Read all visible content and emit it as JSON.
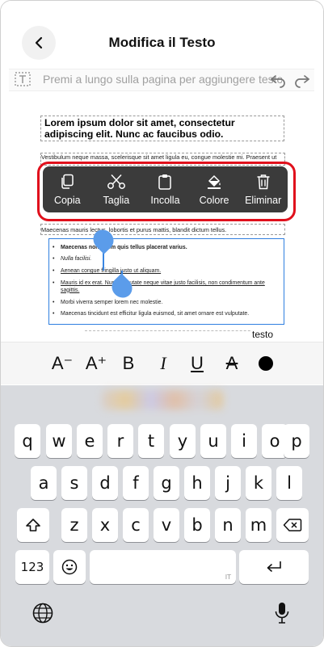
{
  "header": {
    "title": "Modifica il Testo"
  },
  "hint_bar": {
    "text": "Premi a lungo sulla pagina per aggiungere testo"
  },
  "document": {
    "heading": "Lorem ipsum dolor sit amet, consectetur adipiscing elit. Nunc ac faucibus odio.",
    "para1": "Vestibulum neque massa, scelerisque sit amet ligula eu, congue molestie mi. Praesent ut",
    "para2": "Maecenas mauris lectus, lobortis et purus mattis, blandit dictum tellus.",
    "list": [
      "Maecenas non lorem quis tellus placerat varius.",
      "Nulla facilisi.",
      "Aenean congue fringilla justo ut aliquam.",
      "Mauris id ex erat. Nunc vulputate neque vitae justo facilisis, non condimentum ante sagittis.",
      "Morbi viverra semper lorem nec molestie.",
      "Maecenas tincidunt est efficitur ligula euismod, sit amet ornare est vulputate."
    ],
    "testo_tag": "testo"
  },
  "context_menu": {
    "items": [
      {
        "label": "Copia",
        "icon": "copy-icon"
      },
      {
        "label": "Taglia",
        "icon": "scissors-icon"
      },
      {
        "label": "Incolla",
        "icon": "clipboard-icon"
      },
      {
        "label": "Colore",
        "icon": "paint-bucket-icon"
      },
      {
        "label": "Eliminar",
        "icon": "trash-icon"
      }
    ],
    "highlight_color": "#e0101c"
  },
  "format_bar": {
    "decrease_font": "A⁻",
    "increase_font": "A⁺",
    "bold": "B",
    "italic": "I",
    "underline": "U",
    "strikethrough": "A"
  },
  "keyboard": {
    "row1": [
      "q",
      "w",
      "e",
      "r",
      "t",
      "y",
      "u",
      "i",
      "o",
      "p"
    ],
    "row2": [
      "a",
      "s",
      "d",
      "f",
      "g",
      "h",
      "j",
      "k",
      "l"
    ],
    "row3": [
      "z",
      "x",
      "c",
      "v",
      "b",
      "n",
      "m"
    ],
    "numbers_key": "123",
    "space_hint": "IT",
    "accent": "#2f7fe0"
  }
}
